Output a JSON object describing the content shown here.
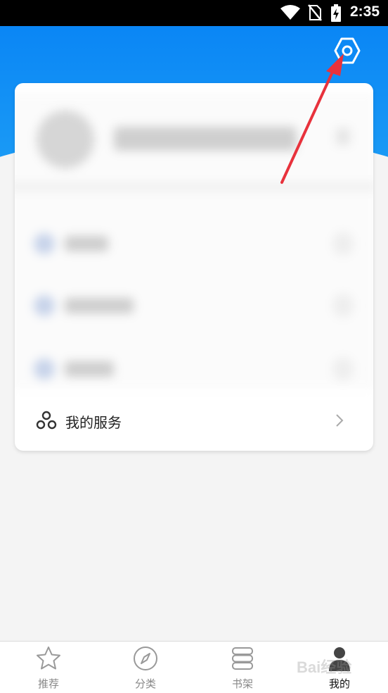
{
  "status_bar": {
    "time": "2:35",
    "icons": [
      "wifi-icon",
      "no-sim-icon",
      "battery-charging-icon"
    ]
  },
  "header": {
    "settings_icon": "settings-hexagon-icon",
    "accent_color": "#0a86f5"
  },
  "card": {
    "service_row": {
      "icon": "service-dots-icon",
      "label": "我的服务"
    }
  },
  "bottom_nav": {
    "items": [
      {
        "label": "推荐",
        "icon": "star-icon",
        "active": false
      },
      {
        "label": "分类",
        "icon": "compass-icon",
        "active": false
      },
      {
        "label": "书架",
        "icon": "bookshelf-icon",
        "active": false
      },
      {
        "label": "我的",
        "icon": "profile-icon",
        "active": true
      }
    ]
  },
  "annotation": {
    "color": "#e8323c"
  },
  "watermark": {
    "text": "Bai经验"
  }
}
